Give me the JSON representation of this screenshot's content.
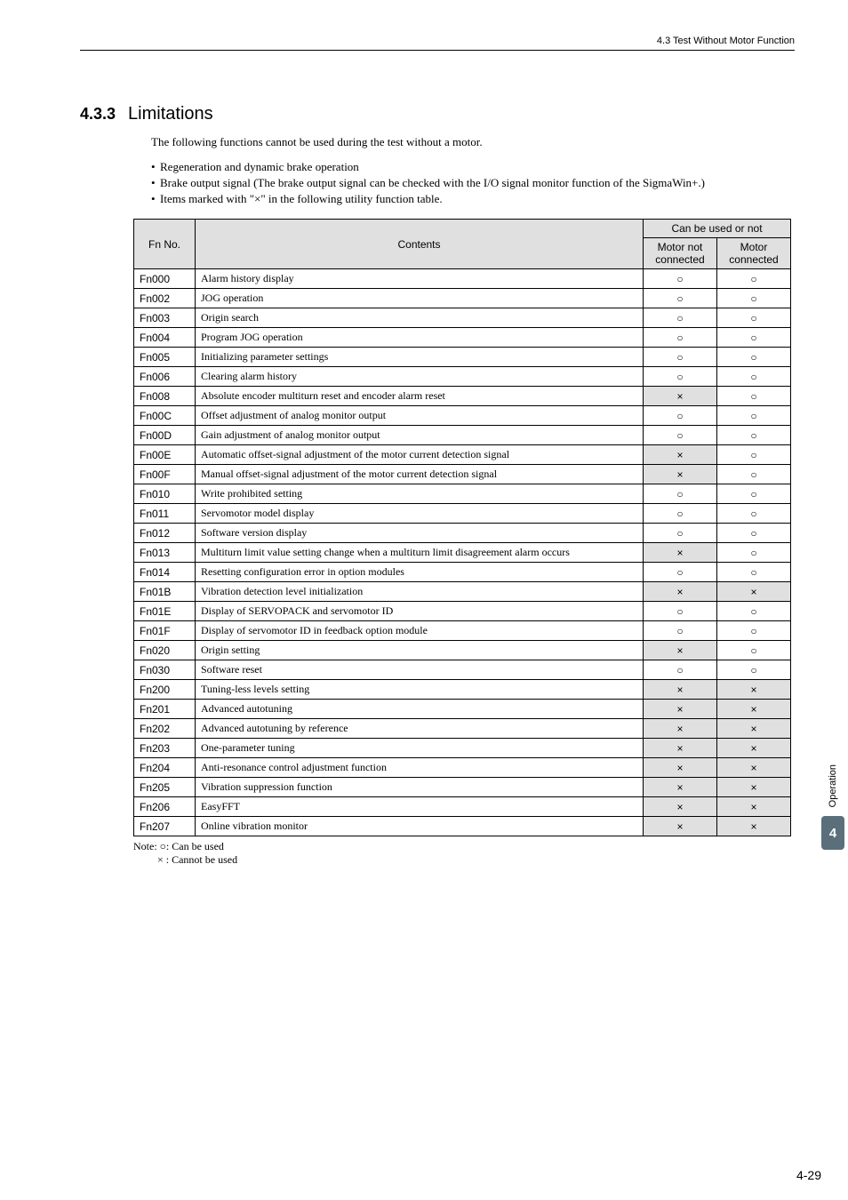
{
  "header": "4.3  Test Without Motor Function",
  "section": {
    "num": "4.3.3",
    "title": "Limitations"
  },
  "intro": "The following functions cannot be used during the test without a motor.",
  "bullets": [
    "Regeneration and dynamic brake operation",
    "Brake output signal (The brake output signal can be checked with the I/O signal monitor function of the SigmaWin+.)",
    "Items marked with \"×\" in the following utility function table."
  ],
  "table": {
    "headers": {
      "fn": "Fn No.",
      "contents": "Contents",
      "canbe": "Can be used or not",
      "not_conn": "Motor not connected",
      "conn": "Motor connected"
    },
    "rows": [
      {
        "fn": "Fn000",
        "c": "Alarm history display",
        "a": "○",
        "b": "○"
      },
      {
        "fn": "Fn002",
        "c": "JOG operation",
        "a": "○",
        "b": "○"
      },
      {
        "fn": "Fn003",
        "c": "Origin search",
        "a": "○",
        "b": "○"
      },
      {
        "fn": "Fn004",
        "c": "Program JOG operation",
        "a": "○",
        "b": "○"
      },
      {
        "fn": "Fn005",
        "c": "Initializing parameter settings",
        "a": "○",
        "b": "○"
      },
      {
        "fn": "Fn006",
        "c": "Clearing alarm history",
        "a": "○",
        "b": "○"
      },
      {
        "fn": "Fn008",
        "c": "Absolute encoder multiturn reset and encoder alarm reset",
        "a": "×",
        "b": "○"
      },
      {
        "fn": "Fn00C",
        "c": "Offset adjustment of analog monitor output",
        "a": "○",
        "b": "○"
      },
      {
        "fn": "Fn00D",
        "c": "Gain adjustment of analog monitor output",
        "a": "○",
        "b": "○"
      },
      {
        "fn": "Fn00E",
        "c": "Automatic offset-signal adjustment of the motor current detection signal",
        "a": "×",
        "b": "○"
      },
      {
        "fn": "Fn00F",
        "c": "Manual offset-signal adjustment of the motor current detection signal",
        "a": "×",
        "b": "○"
      },
      {
        "fn": "Fn010",
        "c": "Write prohibited setting",
        "a": "○",
        "b": "○"
      },
      {
        "fn": "Fn011",
        "c": "Servomotor model display",
        "a": "○",
        "b": "○"
      },
      {
        "fn": "Fn012",
        "c": "Software version display",
        "a": "○",
        "b": "○"
      },
      {
        "fn": "Fn013",
        "c": "Multiturn limit value setting change when a multiturn limit disagreement alarm occurs",
        "a": "×",
        "b": "○"
      },
      {
        "fn": "Fn014",
        "c": "Resetting configuration error in option modules",
        "a": "○",
        "b": "○"
      },
      {
        "fn": "Fn01B",
        "c": "Vibration detection level initialization",
        "a": "×",
        "b": "×"
      },
      {
        "fn": "Fn01E",
        "c": "Display of SERVOPACK and servomotor ID",
        "a": "○",
        "b": "○"
      },
      {
        "fn": "Fn01F",
        "c": "Display of servomotor ID in feedback option module",
        "a": "○",
        "b": "○"
      },
      {
        "fn": "Fn020",
        "c": "Origin setting",
        "a": "×",
        "b": "○"
      },
      {
        "fn": "Fn030",
        "c": "Software reset",
        "a": "○",
        "b": "○"
      },
      {
        "fn": "Fn200",
        "c": "Tuning-less levels setting",
        "a": "×",
        "b": "×"
      },
      {
        "fn": "Fn201",
        "c": "Advanced autotuning",
        "a": "×",
        "b": "×"
      },
      {
        "fn": "Fn202",
        "c": "Advanced autotuning by reference",
        "a": "×",
        "b": "×"
      },
      {
        "fn": "Fn203",
        "c": "One-parameter tuning",
        "a": "×",
        "b": "×"
      },
      {
        "fn": "Fn204",
        "c": "Anti-resonance control adjustment function",
        "a": "×",
        "b": "×"
      },
      {
        "fn": "Fn205",
        "c": "Vibration suppression function",
        "a": "×",
        "b": "×"
      },
      {
        "fn": "Fn206",
        "c": "EasyFFT",
        "a": "×",
        "b": "×"
      },
      {
        "fn": "Fn207",
        "c": "Online vibration monitor",
        "a": "×",
        "b": "×"
      }
    ]
  },
  "note": {
    "line1": "Note: ○: Can be used",
    "line2": "× : Cannot be used"
  },
  "side": {
    "label": "Operation",
    "chapter": "4"
  },
  "page_num": "4-29"
}
